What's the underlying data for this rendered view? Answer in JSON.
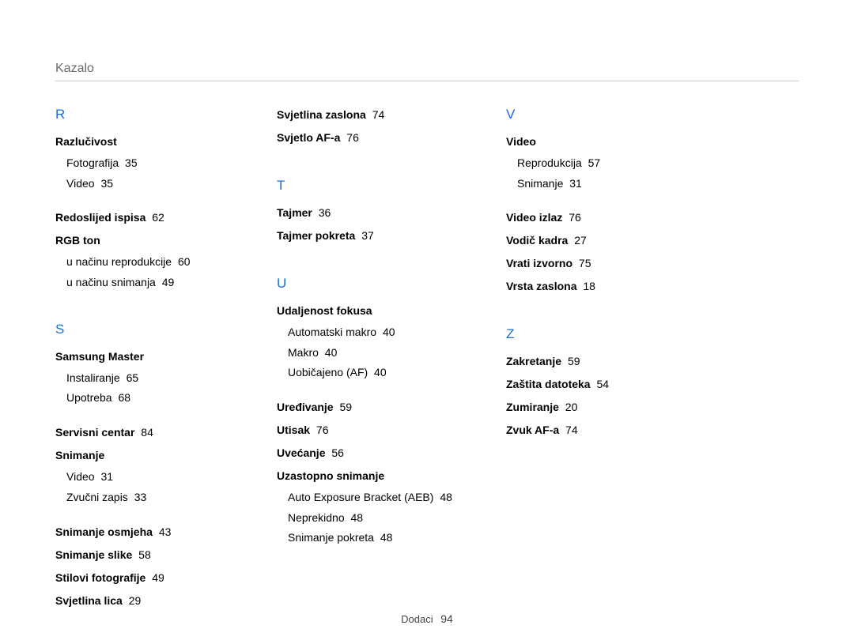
{
  "header": {
    "title": "Kazalo"
  },
  "footer": {
    "label": "Dodaci",
    "page": "94"
  },
  "col1": {
    "R": {
      "letter": "R",
      "razlucivost": {
        "label": "Razlučivost"
      },
      "razlucivost_sub1": {
        "label": "Fotografija",
        "page": "35"
      },
      "razlucivost_sub2": {
        "label": "Video",
        "page": "35"
      },
      "redoslijed": {
        "label": "Redoslijed ispisa",
        "page": "62"
      },
      "rgb": {
        "label": "RGB ton"
      },
      "rgb_sub1": {
        "label": "u načinu reprodukcije",
        "page": "60"
      },
      "rgb_sub2": {
        "label": "u načinu snimanja",
        "page": "49"
      }
    },
    "S": {
      "letter": "S",
      "samsung": {
        "label": "Samsung Master"
      },
      "samsung_sub1": {
        "label": "Instaliranje",
        "page": "65"
      },
      "samsung_sub2": {
        "label": "Upotreba",
        "page": "68"
      },
      "servisni": {
        "label": "Servisni centar",
        "page": "84"
      },
      "snimanje": {
        "label": "Snimanje"
      },
      "snimanje_sub1": {
        "label": "Video",
        "page": "31"
      },
      "snimanje_sub2": {
        "label": "Zvučni zapis",
        "page": "33"
      },
      "osmjeha": {
        "label": "Snimanje osmjeha",
        "page": "43"
      },
      "slike": {
        "label": "Snimanje slike",
        "page": "58"
      },
      "stilovi": {
        "label": "Stilovi fotografije",
        "page": "49"
      },
      "lica": {
        "label": "Svjetlina lica",
        "page": "29"
      }
    }
  },
  "col2": {
    "top": {
      "svjetlina_zaslona": {
        "label": "Svjetlina zaslona",
        "page": "74"
      },
      "svjetlo_af": {
        "label": "Svjetlo AF-a",
        "page": "76"
      }
    },
    "T": {
      "letter": "T",
      "tajmer": {
        "label": "Tajmer",
        "page": "36"
      },
      "tajmer_pokreta": {
        "label": "Tajmer pokreta",
        "page": "37"
      }
    },
    "U": {
      "letter": "U",
      "udaljenost": {
        "label": "Udaljenost fokusa"
      },
      "udaljenost_sub1": {
        "label": "Automatski makro",
        "page": "40"
      },
      "udaljenost_sub2": {
        "label": "Makro",
        "page": "40"
      },
      "udaljenost_sub3": {
        "label": "Uobičajeno (AF)",
        "page": "40"
      },
      "uredivanje": {
        "label": "Uređivanje",
        "page": "59"
      },
      "utisak": {
        "label": "Utisak",
        "page": "76"
      },
      "uvecanje": {
        "label": "Uvećanje",
        "page": "56"
      },
      "uzastopno": {
        "label": "Uzastopno snimanje"
      },
      "uzastopno_sub1": {
        "label": "Auto Exposure Bracket (AEB)",
        "page": "48"
      },
      "uzastopno_sub2": {
        "label": "Neprekidno",
        "page": "48"
      },
      "uzastopno_sub3": {
        "label": "Snimanje pokreta",
        "page": "48"
      }
    }
  },
  "col3": {
    "V": {
      "letter": "V",
      "video": {
        "label": "Video"
      },
      "video_sub1": {
        "label": "Reprodukcija",
        "page": "57"
      },
      "video_sub2": {
        "label": "Snimanje",
        "page": "31"
      },
      "video_izlaz": {
        "label": "Video izlaz",
        "page": "76"
      },
      "vodic": {
        "label": "Vodič kadra",
        "page": "27"
      },
      "vrati": {
        "label": "Vrati izvorno",
        "page": "75"
      },
      "vrsta": {
        "label": "Vrsta zaslona",
        "page": "18"
      }
    },
    "Z": {
      "letter": "Z",
      "zakretanje": {
        "label": "Zakretanje",
        "page": "59"
      },
      "zastita": {
        "label": "Zaštita datoteka",
        "page": "54"
      },
      "zumiranje": {
        "label": "Zumiranje",
        "page": "20"
      },
      "zvuk_af": {
        "label": "Zvuk AF-a",
        "page": "74"
      }
    }
  }
}
